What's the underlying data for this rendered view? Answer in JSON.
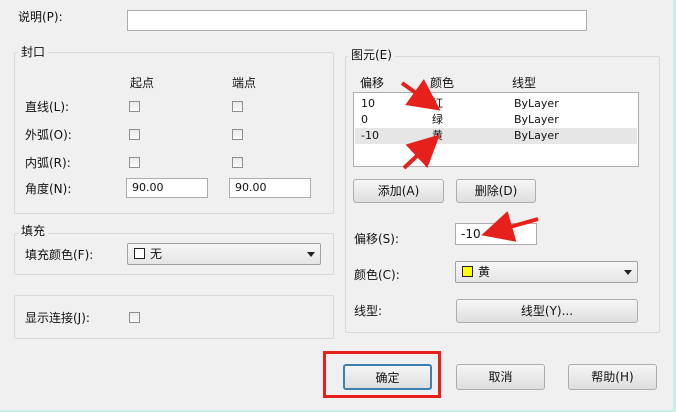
{
  "description": {
    "label": "说明(P):",
    "value": ""
  },
  "caps": {
    "title": "封口",
    "col_start": "起点",
    "col_end": "端点",
    "rows": [
      {
        "label": "直线(L):"
      },
      {
        "label": "外弧(O):"
      },
      {
        "label": "内弧(R):"
      }
    ],
    "angle": {
      "label": "角度(N):",
      "start": "90.00",
      "end": "90.00"
    }
  },
  "fill": {
    "title": "填充",
    "color_label": "填充颜色(F):",
    "color_value": "无",
    "color_swatch": "#ffffff"
  },
  "joints": {
    "label": "显示连接(J):"
  },
  "elements": {
    "title": "图元(E)",
    "headers": [
      "偏移",
      "颜色",
      "线型"
    ],
    "rows": [
      {
        "offset": "10",
        "color": "红",
        "linetype": "ByLayer"
      },
      {
        "offset": "0",
        "color": "绿",
        "linetype": "ByLayer"
      },
      {
        "offset": "-10",
        "color": "黄",
        "linetype": "ByLayer"
      }
    ],
    "add_label": "添加(A)",
    "delete_label": "删除(D)",
    "offset_label": "偏移(S):",
    "offset_value": "-10",
    "color_label": "颜色(C):",
    "color_value": "黄",
    "color_swatch": "#ffff00",
    "linetype_label": "线型:",
    "linetype_button": "线型(Y)..."
  },
  "footer": {
    "ok_label": "确定",
    "cancel_label": "取消",
    "help_label": "帮助(H)"
  },
  "annotation_color": "#e8201b"
}
